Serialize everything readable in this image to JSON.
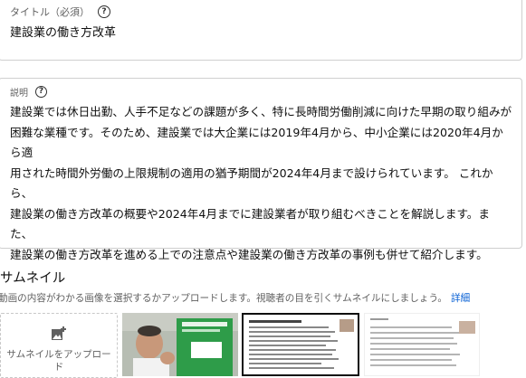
{
  "title_field": {
    "label": "タイトル（必須）",
    "value": "建設業の働き方改革"
  },
  "description_field": {
    "label": "説明",
    "lines": [
      "建設業では休日出勤、人手不足などの課題が多く、特に長時間労働削減に向けた早期の取り組みが",
      "困難な業種です。そのため、建設業では大企業には2019年4月から、中小企業には2020年4月から適",
      "用された時間外労働の上限規制の適用の猶予期間が2024年4月まで設けられています。 これから、",
      "建設業の働き方改革の概要や2024年4月までに建設業者が取り組むべきことを解説します。また、",
      "建設業の働き方改革を進める上での注意点や建設業の働き方改革の事例も併せて紹介します。"
    ]
  },
  "thumbnail_section": {
    "heading": "サムネイル",
    "subtitle": "動画の内容がわかる画像を選択するかアップロードします。視聴者の目を引くサムネイルにしましょう。",
    "more_link": "詳細",
    "upload_label": "サムネイルをアップロード",
    "upload_icon": "add-photo-icon",
    "help_icon": "help-circle-icon"
  },
  "colors": {
    "link": "#065fd4",
    "border": "#cfcfcf",
    "muted_text": "#606060"
  }
}
